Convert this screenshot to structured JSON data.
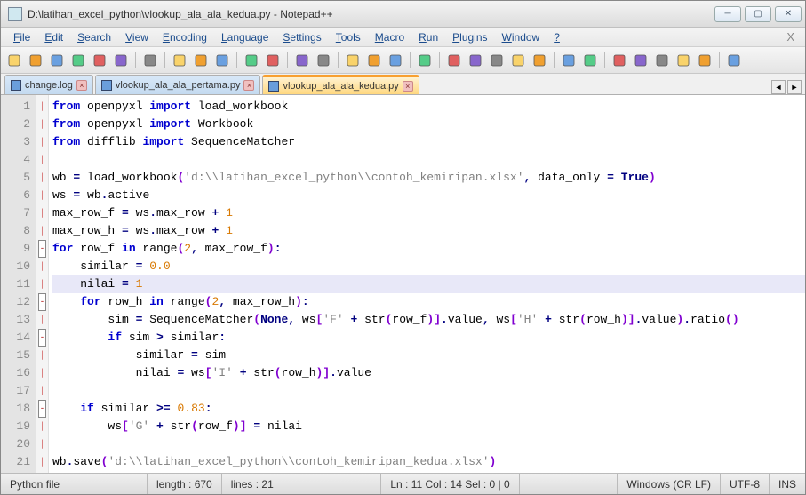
{
  "title": "D:\\latihan_excel_python\\vlookup_ala_ala_kedua.py - Notepad++",
  "menus": [
    "File",
    "Edit",
    "Search",
    "View",
    "Encoding",
    "Language",
    "Settings",
    "Tools",
    "Macro",
    "Run",
    "Plugins",
    "Window",
    "?"
  ],
  "tabs": [
    {
      "label": "change.log",
      "active": false
    },
    {
      "label": "vlookup_ala_ala_pertama.py",
      "active": false
    },
    {
      "label": "vlookup_ala_ala_kedua.py",
      "active": true
    }
  ],
  "line_numbers": [
    "1",
    "2",
    "3",
    "4",
    "5",
    "6",
    "7",
    "8",
    "9",
    "10",
    "11",
    "12",
    "13",
    "14",
    "15",
    "16",
    "17",
    "18",
    "19",
    "20",
    "21"
  ],
  "code_lines": [
    [
      {
        "t": "kw",
        "v": "from"
      },
      {
        "t": "id",
        "v": " openpyxl "
      },
      {
        "t": "kw",
        "v": "import"
      },
      {
        "t": "id",
        "v": " load_workbook"
      }
    ],
    [
      {
        "t": "kw",
        "v": "from"
      },
      {
        "t": "id",
        "v": " openpyxl "
      },
      {
        "t": "kw",
        "v": "import"
      },
      {
        "t": "id",
        "v": " Workbook"
      }
    ],
    [
      {
        "t": "kw",
        "v": "from"
      },
      {
        "t": "id",
        "v": " difflib "
      },
      {
        "t": "kw",
        "v": "import"
      },
      {
        "t": "id",
        "v": " SequenceMatcher"
      }
    ],
    [
      {
        "t": "id",
        "v": ""
      }
    ],
    [
      {
        "t": "id",
        "v": "wb "
      },
      {
        "t": "op",
        "v": "="
      },
      {
        "t": "id",
        "v": " load_workbook"
      },
      {
        "t": "par",
        "v": "("
      },
      {
        "t": "str",
        "v": "'d:\\\\latihan_excel_python\\\\contoh_kemiripan.xlsx'"
      },
      {
        "t": "op",
        "v": ","
      },
      {
        "t": "id",
        "v": " data_only "
      },
      {
        "t": "op",
        "v": "="
      },
      {
        "t": "id",
        "v": " "
      },
      {
        "t": "lit",
        "v": "True"
      },
      {
        "t": "par",
        "v": ")"
      }
    ],
    [
      {
        "t": "id",
        "v": "ws "
      },
      {
        "t": "op",
        "v": "="
      },
      {
        "t": "id",
        "v": " wb"
      },
      {
        "t": "op",
        "v": "."
      },
      {
        "t": "id",
        "v": "active"
      }
    ],
    [
      {
        "t": "id",
        "v": "max_row_f "
      },
      {
        "t": "op",
        "v": "="
      },
      {
        "t": "id",
        "v": " ws"
      },
      {
        "t": "op",
        "v": "."
      },
      {
        "t": "id",
        "v": "max_row "
      },
      {
        "t": "op",
        "v": "+"
      },
      {
        "t": "id",
        "v": " "
      },
      {
        "t": "num",
        "v": "1"
      }
    ],
    [
      {
        "t": "id",
        "v": "max_row_h "
      },
      {
        "t": "op",
        "v": "="
      },
      {
        "t": "id",
        "v": " ws"
      },
      {
        "t": "op",
        "v": "."
      },
      {
        "t": "id",
        "v": "max_row "
      },
      {
        "t": "op",
        "v": "+"
      },
      {
        "t": "id",
        "v": " "
      },
      {
        "t": "num",
        "v": "1"
      }
    ],
    [
      {
        "t": "kw",
        "v": "for"
      },
      {
        "t": "id",
        "v": " row_f "
      },
      {
        "t": "kw",
        "v": "in"
      },
      {
        "t": "id",
        "v": " range"
      },
      {
        "t": "par",
        "v": "("
      },
      {
        "t": "num",
        "v": "2"
      },
      {
        "t": "op",
        "v": ","
      },
      {
        "t": "id",
        "v": " max_row_f"
      },
      {
        "t": "par",
        "v": ")"
      },
      {
        "t": "op",
        "v": ":"
      }
    ],
    [
      {
        "t": "id",
        "v": "    similar "
      },
      {
        "t": "op",
        "v": "="
      },
      {
        "t": "id",
        "v": " "
      },
      {
        "t": "num",
        "v": "0.0"
      }
    ],
    [
      {
        "t": "id",
        "v": "    nilai "
      },
      {
        "t": "op",
        "v": "="
      },
      {
        "t": "id",
        "v": " "
      },
      {
        "t": "num",
        "v": "1"
      }
    ],
    [
      {
        "t": "id",
        "v": "    "
      },
      {
        "t": "kw",
        "v": "for"
      },
      {
        "t": "id",
        "v": " row_h "
      },
      {
        "t": "kw",
        "v": "in"
      },
      {
        "t": "id",
        "v": " range"
      },
      {
        "t": "par",
        "v": "("
      },
      {
        "t": "num",
        "v": "2"
      },
      {
        "t": "op",
        "v": ","
      },
      {
        "t": "id",
        "v": " max_row_h"
      },
      {
        "t": "par",
        "v": ")"
      },
      {
        "t": "op",
        "v": ":"
      }
    ],
    [
      {
        "t": "id",
        "v": "        sim "
      },
      {
        "t": "op",
        "v": "="
      },
      {
        "t": "id",
        "v": " SequenceMatcher"
      },
      {
        "t": "par",
        "v": "("
      },
      {
        "t": "lit",
        "v": "None"
      },
      {
        "t": "op",
        "v": ","
      },
      {
        "t": "id",
        "v": " ws"
      },
      {
        "t": "par",
        "v": "["
      },
      {
        "t": "str",
        "v": "'F'"
      },
      {
        "t": "id",
        "v": " "
      },
      {
        "t": "op",
        "v": "+"
      },
      {
        "t": "id",
        "v": " str"
      },
      {
        "t": "par",
        "v": "("
      },
      {
        "t": "id",
        "v": "row_f"
      },
      {
        "t": "par",
        "v": ")]"
      },
      {
        "t": "op",
        "v": "."
      },
      {
        "t": "id",
        "v": "value"
      },
      {
        "t": "op",
        "v": ","
      },
      {
        "t": "id",
        "v": " ws"
      },
      {
        "t": "par",
        "v": "["
      },
      {
        "t": "str",
        "v": "'H'"
      },
      {
        "t": "id",
        "v": " "
      },
      {
        "t": "op",
        "v": "+"
      },
      {
        "t": "id",
        "v": " str"
      },
      {
        "t": "par",
        "v": "("
      },
      {
        "t": "id",
        "v": "row_h"
      },
      {
        "t": "par",
        "v": ")]"
      },
      {
        "t": "op",
        "v": "."
      },
      {
        "t": "id",
        "v": "value"
      },
      {
        "t": "par",
        "v": ")"
      },
      {
        "t": "op",
        "v": "."
      },
      {
        "t": "id",
        "v": "ratio"
      },
      {
        "t": "par",
        "v": "()"
      }
    ],
    [
      {
        "t": "id",
        "v": "        "
      },
      {
        "t": "kw",
        "v": "if"
      },
      {
        "t": "id",
        "v": " sim "
      },
      {
        "t": "op",
        "v": ">"
      },
      {
        "t": "id",
        "v": " similar"
      },
      {
        "t": "op",
        "v": ":"
      }
    ],
    [
      {
        "t": "id",
        "v": "            similar "
      },
      {
        "t": "op",
        "v": "="
      },
      {
        "t": "id",
        "v": " sim"
      }
    ],
    [
      {
        "t": "id",
        "v": "            nilai "
      },
      {
        "t": "op",
        "v": "="
      },
      {
        "t": "id",
        "v": " ws"
      },
      {
        "t": "par",
        "v": "["
      },
      {
        "t": "str",
        "v": "'I'"
      },
      {
        "t": "id",
        "v": " "
      },
      {
        "t": "op",
        "v": "+"
      },
      {
        "t": "id",
        "v": " str"
      },
      {
        "t": "par",
        "v": "("
      },
      {
        "t": "id",
        "v": "row_h"
      },
      {
        "t": "par",
        "v": ")]"
      },
      {
        "t": "op",
        "v": "."
      },
      {
        "t": "id",
        "v": "value"
      }
    ],
    [
      {
        "t": "id",
        "v": ""
      }
    ],
    [
      {
        "t": "id",
        "v": "    "
      },
      {
        "t": "kw",
        "v": "if"
      },
      {
        "t": "id",
        "v": " similar "
      },
      {
        "t": "op",
        "v": ">="
      },
      {
        "t": "id",
        "v": " "
      },
      {
        "t": "num",
        "v": "0.83"
      },
      {
        "t": "op",
        "v": ":"
      }
    ],
    [
      {
        "t": "id",
        "v": "        ws"
      },
      {
        "t": "par",
        "v": "["
      },
      {
        "t": "str",
        "v": "'G'"
      },
      {
        "t": "id",
        "v": " "
      },
      {
        "t": "op",
        "v": "+"
      },
      {
        "t": "id",
        "v": " str"
      },
      {
        "t": "par",
        "v": "("
      },
      {
        "t": "id",
        "v": "row_f"
      },
      {
        "t": "par",
        "v": ")]"
      },
      {
        "t": "id",
        "v": " "
      },
      {
        "t": "op",
        "v": "="
      },
      {
        "t": "id",
        "v": " nilai"
      }
    ],
    [
      {
        "t": "id",
        "v": ""
      }
    ],
    [
      {
        "t": "id",
        "v": "wb"
      },
      {
        "t": "op",
        "v": "."
      },
      {
        "t": "id",
        "v": "save"
      },
      {
        "t": "par",
        "v": "("
      },
      {
        "t": "str",
        "v": "'d:\\\\latihan_excel_python\\\\contoh_kemiripan_kedua.xlsx'"
      },
      {
        "t": "par",
        "v": ")"
      }
    ]
  ],
  "folds": {
    "9": "box",
    "12": "box",
    "14": "box",
    "18": "box"
  },
  "current_line": 11,
  "status": {
    "lang": "Python file",
    "length": "length : 670",
    "lines": "lines : 21",
    "pos": "Ln : 11    Col : 14    Sel : 0 | 0",
    "eol": "Windows (CR LF)",
    "enc": "UTF-8",
    "ins": "INS"
  },
  "toolbar_icons": [
    "new",
    "open",
    "save",
    "save-all",
    "close",
    "close-all",
    "print",
    "cut",
    "copy",
    "paste",
    "undo",
    "redo",
    "find",
    "replace",
    "zoom-in",
    "zoom-out",
    "sync",
    "wrap",
    "invis",
    "indent",
    "fold",
    "unfold",
    "comment",
    "bookmark",
    "func",
    "rec",
    "play",
    "play2",
    "play3",
    "stop",
    "abc"
  ]
}
